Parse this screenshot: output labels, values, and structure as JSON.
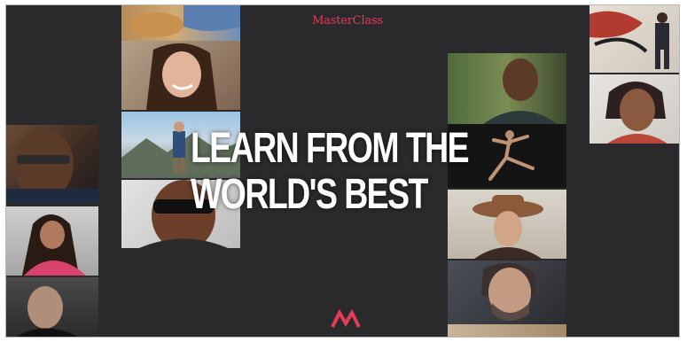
{
  "brand": {
    "name": "MasterClass"
  },
  "hero": {
    "headline_line1": "LEARN FROM THE",
    "headline_line2": "WORLD'S BEST"
  },
  "colors": {
    "background": "#2a2a2c",
    "brand_red": "#e53b56",
    "headline": "#ffffff"
  },
  "icons": {
    "logo": "masterclass-m-logo"
  }
}
